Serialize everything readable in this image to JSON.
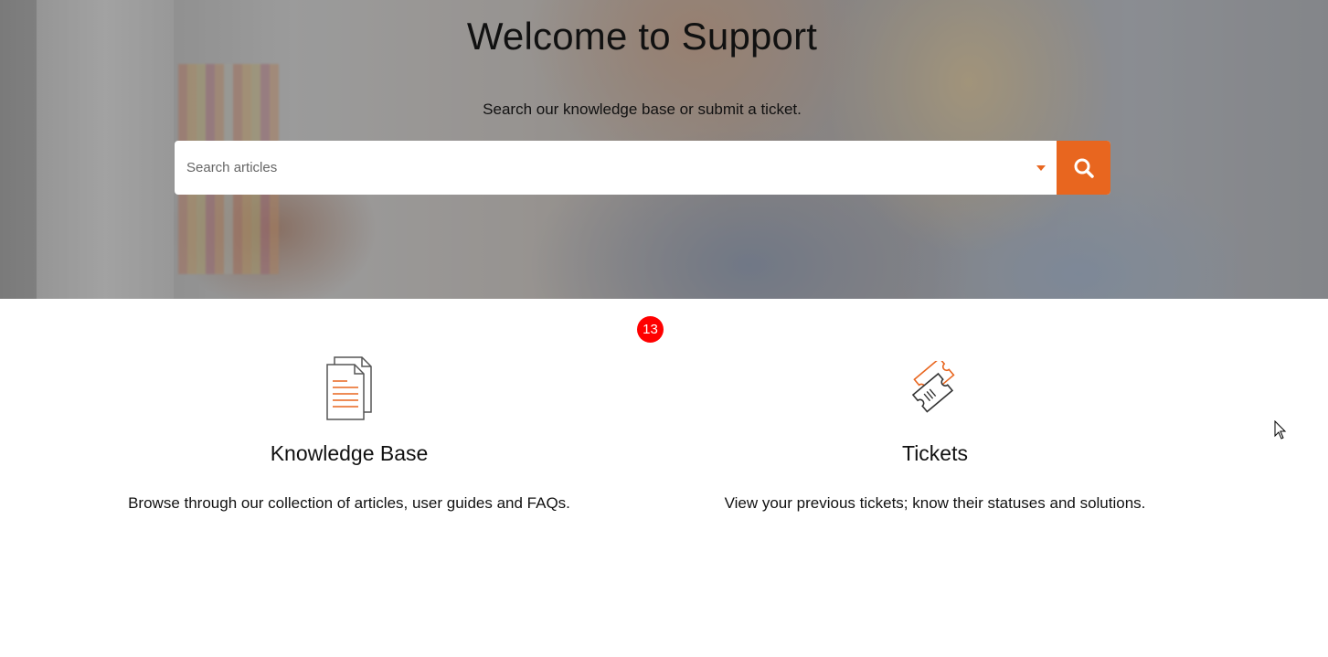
{
  "hero": {
    "title": "Welcome to Support",
    "subtitle": "Search our knowledge base or submit a ticket."
  },
  "search": {
    "placeholder": "Search articles",
    "value": "",
    "dropdown_icon": "caret-down-icon",
    "button_icon": "search-icon"
  },
  "badge": {
    "count": "13"
  },
  "cards": [
    {
      "icon": "document-icon",
      "title": "Knowledge Base",
      "description": "Browse through our collection of articles, user guides and FAQs."
    },
    {
      "icon": "ticket-icon",
      "title": "Tickets",
      "description": "View your previous tickets; know their statuses and solutions."
    }
  ],
  "colors": {
    "accent": "#e8661f",
    "badge": "#ff0000",
    "text": "#111111"
  }
}
